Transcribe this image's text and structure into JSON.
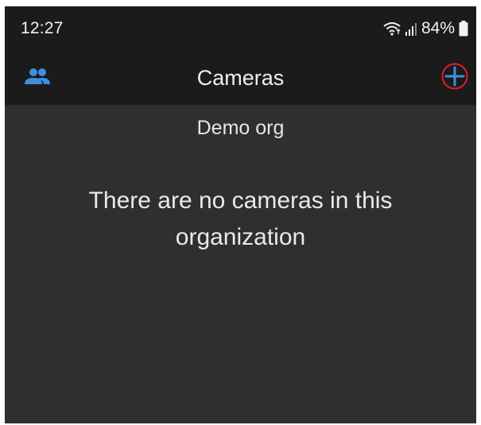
{
  "status_bar": {
    "time": "12:27",
    "battery_percent": "84%",
    "icons": [
      "wifi-icon",
      "signal-icon",
      "battery-icon"
    ]
  },
  "app_bar": {
    "title": "Cameras",
    "left_icon": "members-icon",
    "right_icon": "add-icon"
  },
  "content": {
    "organization_name": "Demo org",
    "empty_message": "There are no cameras in this organization"
  },
  "colors": {
    "accent": "#3d8fe0",
    "highlight_ring": "#e0202a",
    "background": "#2f2f2f",
    "bar_background": "#1b1b1b"
  }
}
